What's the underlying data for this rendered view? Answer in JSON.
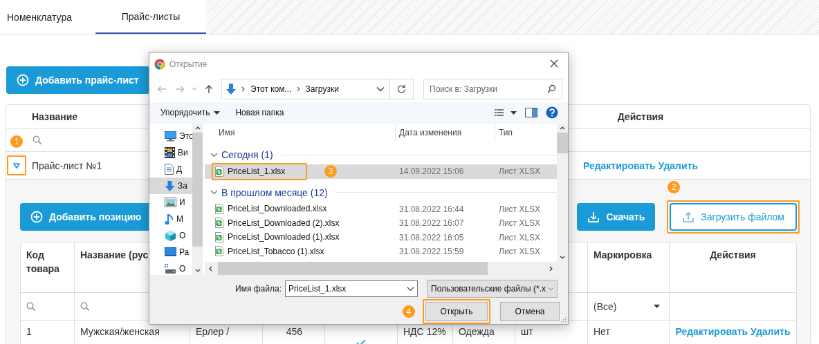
{
  "tabs": [
    {
      "label": "Номенклатура",
      "selected": false
    },
    {
      "label": "Прайс-листы",
      "selected": true
    }
  ],
  "add_pricelist_button": "Добавить прайс-лист",
  "pricelists": {
    "columns": [
      "Название",
      "Действия"
    ],
    "rows": [
      {
        "name": "Прайс-лист №1",
        "expanded": true,
        "callout": "1",
        "actions": [
          "Редактировать",
          "Удалить"
        ]
      }
    ]
  },
  "positions": {
    "add_button": "Добавить позицию",
    "download_button": "Скачать",
    "upload_button": {
      "label": "Загрузить файлом",
      "callout": "2"
    },
    "columns": [
      {
        "label": "Код товара",
        "filter": {
          "kind": "search"
        }
      },
      {
        "label": "Название (рус",
        "filter": {
          "kind": "search"
        }
      },
      {},
      {},
      {},
      {},
      {},
      {},
      {
        "label": "Маркировка",
        "filter": {
          "kind": "select",
          "value": "(Все)"
        }
      },
      {
        "label": "Действия"
      }
    ],
    "rows": [
      {
        "cells": [
          {
            "kind": "text",
            "text": "1"
          },
          {
            "kind": "text",
            "text": "Мужская/женская"
          },
          {
            "kind": "text",
            "text": "Ерлер /"
          },
          {
            "kind": "number",
            "text": "456"
          },
          {
            "kind": "check",
            "checked": true
          },
          {
            "kind": "text",
            "text": "НДС 12%"
          },
          {
            "kind": "text",
            "text": "Одежда"
          },
          {
            "kind": "text",
            "text": "шт"
          },
          {
            "kind": "text",
            "text": "Нет"
          },
          {
            "kind": "actions",
            "actions": [
              "Редактировать",
              "Удалить"
            ]
          }
        ]
      }
    ]
  },
  "dialog": {
    "title": "Открытие",
    "path": [
      "Этот ком...",
      "Загрузки"
    ],
    "search_placeholder": "Поиск в: Загрузки",
    "organize": "Упорядочить",
    "new_folder": "Новая папка",
    "nav_items": [
      {
        "label": "Это",
        "kind": "computer",
        "selected": false
      },
      {
        "label": "Ви",
        "kind": "video",
        "selected": false
      },
      {
        "label": "Д",
        "kind": "document",
        "selected": false
      },
      {
        "label": "За",
        "kind": "download",
        "selected": true
      },
      {
        "label": "И",
        "kind": "image",
        "selected": false
      },
      {
        "label": "М",
        "kind": "music",
        "selected": false
      },
      {
        "label": "О",
        "kind": "cube",
        "selected": false
      },
      {
        "label": "Ра",
        "kind": "desktop",
        "selected": false
      },
      {
        "label": "О",
        "kind": "drive",
        "selected": false
      }
    ],
    "columns": [
      "Имя",
      "Дата изменения",
      "Тип"
    ],
    "groups": [
      {
        "label": "Сегодня (1)",
        "files": [
          {
            "name": "PriceList_1.xlsx",
            "date": "14.09.2022 15:06",
            "type": "Лист XLSX",
            "selected": true,
            "callout": "3"
          }
        ]
      },
      {
        "label": "В прошлом месяце (12)",
        "files": [
          {
            "name": "PriceList_Downloaded.xlsx",
            "date": "31.08.2022 16:44",
            "type": "Лист XLSX",
            "selected": false
          },
          {
            "name": "PriceList_Downloaded (2).xlsx",
            "date": "31.08.2022 16:07",
            "type": "Лист XLSX",
            "selected": false
          },
          {
            "name": "PriceList_Downloaded (1).xlsx",
            "date": "31.08.2022 16:05",
            "type": "Лист XLSX",
            "selected": false
          },
          {
            "name": "PriceList_Tobacco (1).xlsx",
            "date": "31.08.2022 15:59",
            "type": "Лист XLSX",
            "selected": false
          }
        ]
      }
    ],
    "file_name_label": "Имя файла:",
    "file_name": "PriceList_1.xlsx",
    "file_type": "Пользовательские файлы (*.x",
    "open_button": {
      "label": "Открыть",
      "callout": "4"
    },
    "cancel_button": "Отмена"
  }
}
